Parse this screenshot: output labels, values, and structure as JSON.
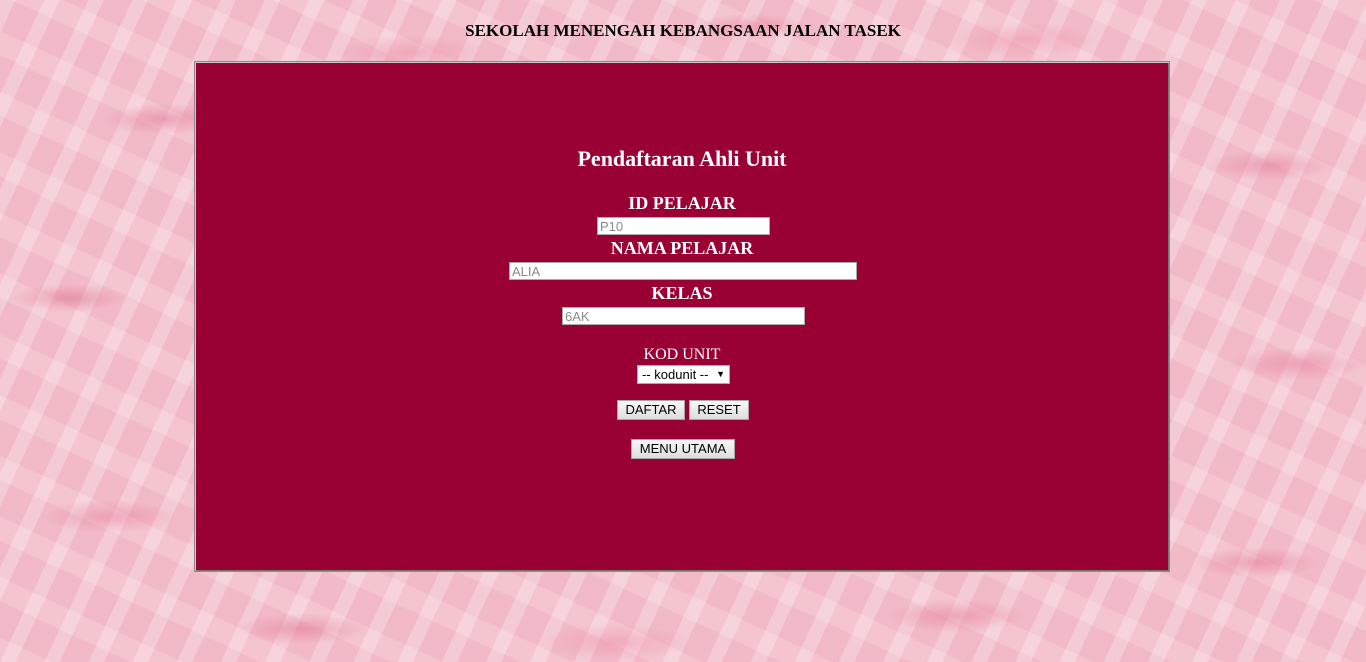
{
  "header": {
    "school_name": "SEKOLAH MENENGAH KEBANGSAAN JALAN TASEK"
  },
  "form": {
    "title": "Pendaftaran Ahli Unit",
    "id_label": "ID PELAJAR",
    "id_placeholder": "P10",
    "name_label": "NAMA PELAJAR",
    "name_placeholder": "ALIA",
    "class_label": "KELAS",
    "class_placeholder": "6AK",
    "unit_label": "KOD UNIT",
    "unit_select_value": "-- kodunit --",
    "submit_label": "DAFTAR",
    "reset_label": "RESET",
    "menu_label": "MENU UTAMA"
  },
  "colors": {
    "panel_background": "#990033",
    "page_background": "#f3c6d0",
    "label_text": "#ffffff"
  },
  "icons": {
    "select_arrow": "chevron-down-icon"
  }
}
